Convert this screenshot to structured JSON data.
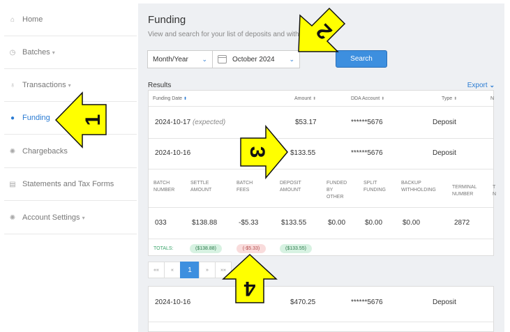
{
  "sidebar": {
    "items": [
      {
        "label": "Home",
        "icon": "home-icon",
        "caret": ""
      },
      {
        "label": "Batches",
        "icon": "clock-icon",
        "caret": "▾"
      },
      {
        "label": "Transactions",
        "icon": "money-bag-icon",
        "caret": "▾"
      },
      {
        "label": "Funding",
        "icon": "piggy-bank-icon",
        "caret": ""
      },
      {
        "label": "Chargebacks",
        "icon": "gear-icon",
        "caret": ""
      },
      {
        "label": "Statements and Tax Forms",
        "icon": "document-icon",
        "caret": ""
      },
      {
        "label": "Account Settings",
        "icon": "gear-icon",
        "caret": "▾"
      }
    ]
  },
  "page": {
    "title": "Funding",
    "subtitle": "View and search for your list of deposits and withd"
  },
  "filters": {
    "period_type": "Month/Year",
    "month": "October 2024",
    "search_label": "Search"
  },
  "results": {
    "label": "Results",
    "export_label": "Export",
    "columns": [
      "Funding Date",
      "Amount",
      "DDA Account",
      "Type",
      "N"
    ],
    "rows": [
      {
        "date": "2024-10-17",
        "note": "(expected)",
        "amount": "$53.17",
        "account": "******5676",
        "type": "Deposit"
      },
      {
        "date": "2024-10-16",
        "note": "",
        "amount": "$133.55",
        "account": "******5676",
        "type": "Deposit"
      }
    ],
    "detail": {
      "headers": [
        "BATCH NUMBER",
        "SETTLE AMOUNT",
        "BATCH FEES",
        "DEPOSIT AMOUNT",
        "FUNDED BY OTHER",
        "SPLIT FUNDING",
        "BACKUP WITHHOLDING",
        "TERMINAL NUMBER",
        "T N"
      ],
      "row": [
        "033",
        "$138.88",
        "-$5.33",
        "$133.55",
        "$0.00",
        "$0.00",
        "$0.00",
        "2872"
      ],
      "totals_label": "TOTALS:",
      "totals": [
        "($138.88)",
        "(-$5.33)",
        "($133.55)"
      ]
    },
    "pager": [
      "««",
      "«",
      "1",
      "»",
      "»»"
    ],
    "next_row": {
      "date": "2024-10-16",
      "amount": "$470.25",
      "account": "******5676",
      "type": "Deposit"
    }
  },
  "annotations": [
    "1",
    "2",
    "3",
    "4"
  ],
  "colors": {
    "accent": "#2a7bd3",
    "button": "#3d8fdf",
    "arrow": "#ffff00"
  }
}
